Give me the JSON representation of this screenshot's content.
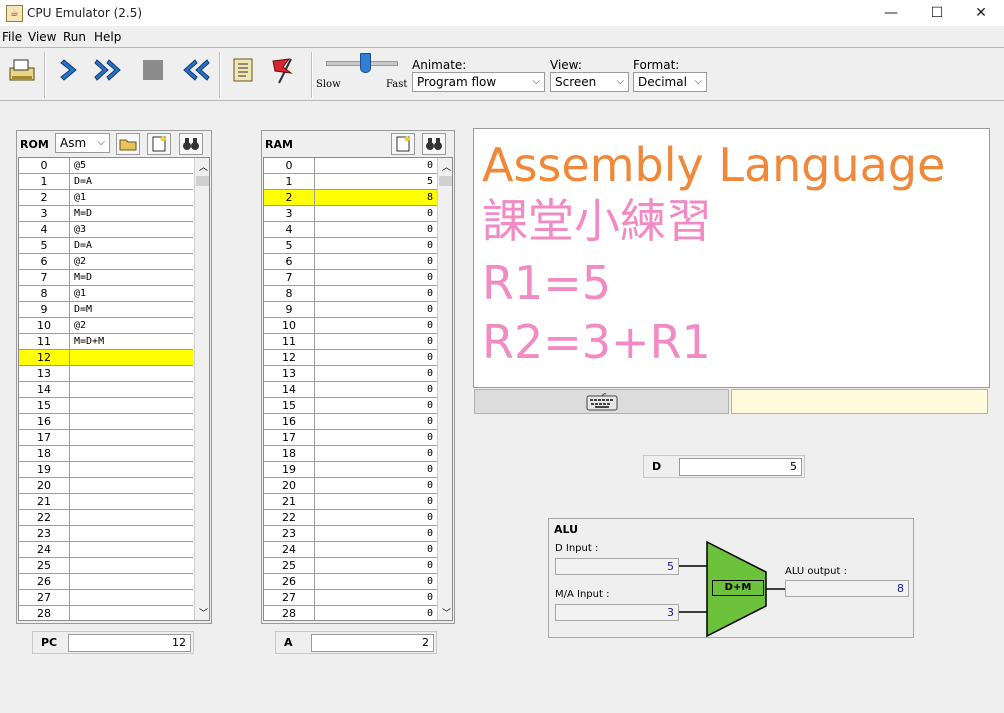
{
  "window": {
    "title": "CPU Emulator (2.5)",
    "minimize": "—",
    "maximize": "☐",
    "close": "✕"
  },
  "menu": [
    "File",
    "View",
    "Run",
    "Help"
  ],
  "toolbar": {
    "speed_slow": "Slow",
    "speed_fast": "Fast",
    "speed_level": 0.55,
    "animate_label": "Animate:",
    "animate_value": "Program flow",
    "view_label": "View:",
    "view_value": "Screen",
    "format_label": "Format:",
    "format_value": "Decimal"
  },
  "rom": {
    "label": "ROM",
    "mode": "Asm",
    "highlight_row": 12,
    "rows": [
      {
        "addr": "0",
        "val": "@5"
      },
      {
        "addr": "1",
        "val": "D=A"
      },
      {
        "addr": "2",
        "val": "@1"
      },
      {
        "addr": "3",
        "val": "M=D"
      },
      {
        "addr": "4",
        "val": "@3"
      },
      {
        "addr": "5",
        "val": "D=A"
      },
      {
        "addr": "6",
        "val": "@2"
      },
      {
        "addr": "7",
        "val": "M=D"
      },
      {
        "addr": "8",
        "val": "@1"
      },
      {
        "addr": "9",
        "val": "D=M"
      },
      {
        "addr": "10",
        "val": "@2"
      },
      {
        "addr": "11",
        "val": "M=D+M"
      },
      {
        "addr": "12",
        "val": ""
      },
      {
        "addr": "13",
        "val": ""
      },
      {
        "addr": "14",
        "val": ""
      },
      {
        "addr": "15",
        "val": ""
      },
      {
        "addr": "16",
        "val": ""
      },
      {
        "addr": "17",
        "val": ""
      },
      {
        "addr": "18",
        "val": ""
      },
      {
        "addr": "19",
        "val": ""
      },
      {
        "addr": "20",
        "val": ""
      },
      {
        "addr": "21",
        "val": ""
      },
      {
        "addr": "22",
        "val": ""
      },
      {
        "addr": "23",
        "val": ""
      },
      {
        "addr": "24",
        "val": ""
      },
      {
        "addr": "25",
        "val": ""
      },
      {
        "addr": "26",
        "val": ""
      },
      {
        "addr": "27",
        "val": ""
      },
      {
        "addr": "28",
        "val": ""
      }
    ]
  },
  "ram": {
    "label": "RAM",
    "highlight_row": 2,
    "rows": [
      {
        "addr": "0",
        "val": "0"
      },
      {
        "addr": "1",
        "val": "5"
      },
      {
        "addr": "2",
        "val": "8"
      },
      {
        "addr": "3",
        "val": "0"
      },
      {
        "addr": "4",
        "val": "0"
      },
      {
        "addr": "5",
        "val": "0"
      },
      {
        "addr": "6",
        "val": "0"
      },
      {
        "addr": "7",
        "val": "0"
      },
      {
        "addr": "8",
        "val": "0"
      },
      {
        "addr": "9",
        "val": "0"
      },
      {
        "addr": "10",
        "val": "0"
      },
      {
        "addr": "11",
        "val": "0"
      },
      {
        "addr": "12",
        "val": "0"
      },
      {
        "addr": "13",
        "val": "0"
      },
      {
        "addr": "14",
        "val": "0"
      },
      {
        "addr": "15",
        "val": "0"
      },
      {
        "addr": "16",
        "val": "0"
      },
      {
        "addr": "17",
        "val": "0"
      },
      {
        "addr": "18",
        "val": "0"
      },
      {
        "addr": "19",
        "val": "0"
      },
      {
        "addr": "20",
        "val": "0"
      },
      {
        "addr": "21",
        "val": "0"
      },
      {
        "addr": "22",
        "val": "0"
      },
      {
        "addr": "23",
        "val": "0"
      },
      {
        "addr": "24",
        "val": "0"
      },
      {
        "addr": "25",
        "val": "0"
      },
      {
        "addr": "26",
        "val": "0"
      },
      {
        "addr": "27",
        "val": "0"
      },
      {
        "addr": "28",
        "val": "0"
      }
    ]
  },
  "registers": {
    "pc_label": "PC",
    "pc_value": "12",
    "a_label": "A",
    "a_value": "2",
    "d_label": "D",
    "d_value": "5"
  },
  "screen": {
    "line1": "Assembly  Language",
    "line2": "課堂小練習",
    "line3": "R1=5",
    "line4": "R2=3+R1",
    "color_orange": "#f0883a",
    "color_pink": "#f28ac4"
  },
  "alu": {
    "title": "ALU",
    "d_input_label": "D Input :",
    "d_input_value": "5",
    "ma_input_label": "M/A Input :",
    "ma_input_value": "3",
    "operation": "D+M",
    "output_label": "ALU output :",
    "output_value": "8",
    "body_color": "#6cc23a"
  }
}
